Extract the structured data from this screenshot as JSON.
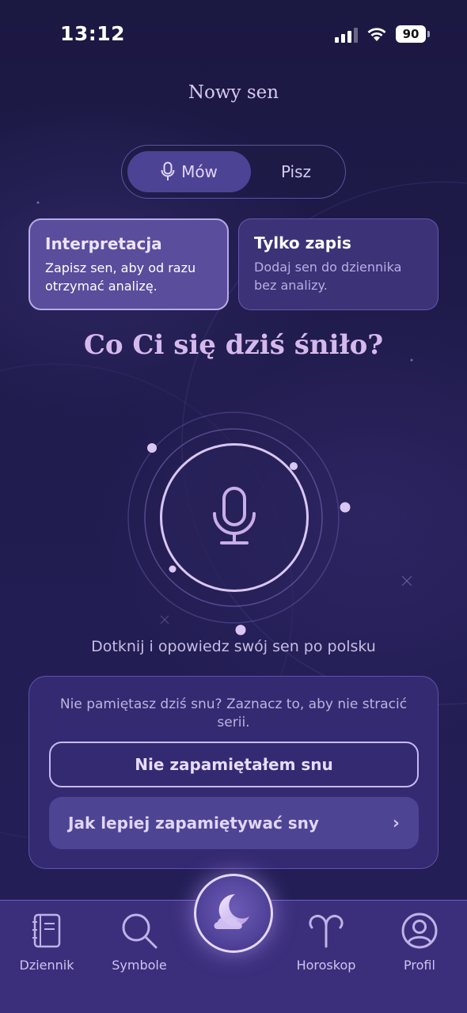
{
  "status_bar": {
    "time": "13:12",
    "battery": "90"
  },
  "header": {
    "title": "Nowy sen"
  },
  "input_mode": {
    "speak_label": "Mów",
    "write_label": "Pisz"
  },
  "modes": [
    {
      "title": "Interpretacja",
      "description": "Zapisz sen, aby od razu otrzymać analizę."
    },
    {
      "title": "Tylko zapis",
      "description": "Dodaj sen do dziennika bez analizy."
    }
  ],
  "main": {
    "question": "Co Ci się dziś śniło?",
    "hint": "Dotknij i opowiedz swój sen po polsku"
  },
  "no_dream": {
    "text": "Nie pamiętasz dziś snu? Zaznacz to, aby nie stracić serii.",
    "button_label": "Nie zapamiętałem snu",
    "tips_label": "Jak lepiej zapamiętywać sny"
  },
  "tabbar": {
    "items": [
      {
        "label": "Dziennik",
        "icon": "journal-icon"
      },
      {
        "label": "Symbole",
        "icon": "search-icon"
      },
      {
        "label": "Horoskop",
        "icon": "aries-icon"
      },
      {
        "label": "Profil",
        "icon": "profile-icon"
      }
    ],
    "center_icon": "moon-cloud-icon"
  },
  "colors": {
    "background": "#1d1a45",
    "accent": "#d6b9ec",
    "card_active": "#5a4d9c",
    "panel": "#342a72"
  }
}
